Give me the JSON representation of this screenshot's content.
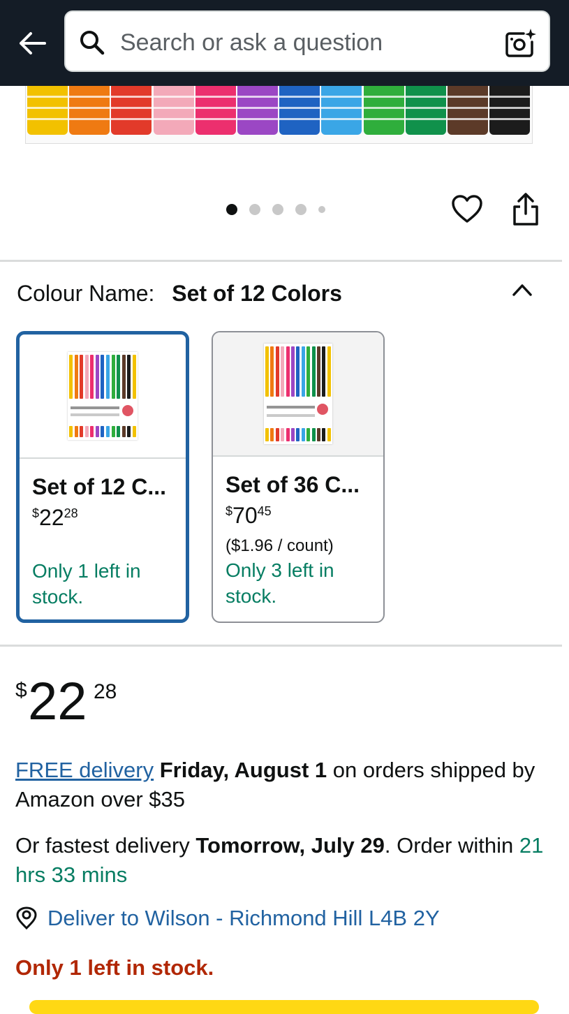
{
  "header": {
    "back_icon": "arrow-left-icon",
    "search_placeholder": "Search or ask a question",
    "search_value": "",
    "camera_icon": "camera-sparkle-icon"
  },
  "gallery": {
    "pen_colors": [
      "#f2c100",
      "#ef7a12",
      "#e23a2a",
      "#f3a9b9",
      "#ec2f6e",
      "#9b47c4",
      "#1f63c2",
      "#3aa6e6",
      "#2fae3c",
      "#10914b",
      "#5c3a28",
      "#1c1c1c"
    ],
    "dot_count": 5,
    "active_dot": 0,
    "wishlist_icon": "heart-outline-icon",
    "share_icon": "share-icon"
  },
  "colour_selector": {
    "label": "Colour Name:",
    "value": "Set of 12 Colors",
    "collapse_icon": "chevron-up-icon",
    "options": [
      {
        "title": "Set of 12 C...",
        "price_whole": "22",
        "price_fraction": "28",
        "currency": "$",
        "unit_price": "",
        "stock": "Only 1 left in stock.",
        "selected": true,
        "badge_text": "12"
      },
      {
        "title": "Set of 36 C...",
        "price_whole": "70",
        "price_fraction": "45",
        "currency": "$",
        "unit_price": "($1.96 / count)",
        "stock": "Only 3 left in stock.",
        "selected": false,
        "badge_text": "36"
      }
    ]
  },
  "price": {
    "currency": "$",
    "whole": "22",
    "fraction": "28"
  },
  "delivery": {
    "free_link": "FREE delivery",
    "free_date": "Friday, August 1",
    "free_suffix": " on orders shipped by Amazon over $35",
    "fast_prefix": "Or fastest delivery ",
    "fast_date": "Tomorrow, July 29",
    "fast_mid": ". Order within ",
    "fast_countdown": "21 hrs 33 mins",
    "location_icon": "location-pin-icon",
    "deliver_to": "Deliver to Wilson - Richmond Hill L4B 2Y"
  },
  "stock_warning": "Only 1 left in stock.",
  "colors": {
    "header_bg": "#141c26",
    "link": "#2162a1",
    "in_stock_green": "#067d62",
    "warning_red": "#b12704",
    "selected_border": "#2162a1",
    "buy_button": "#ffd814"
  }
}
